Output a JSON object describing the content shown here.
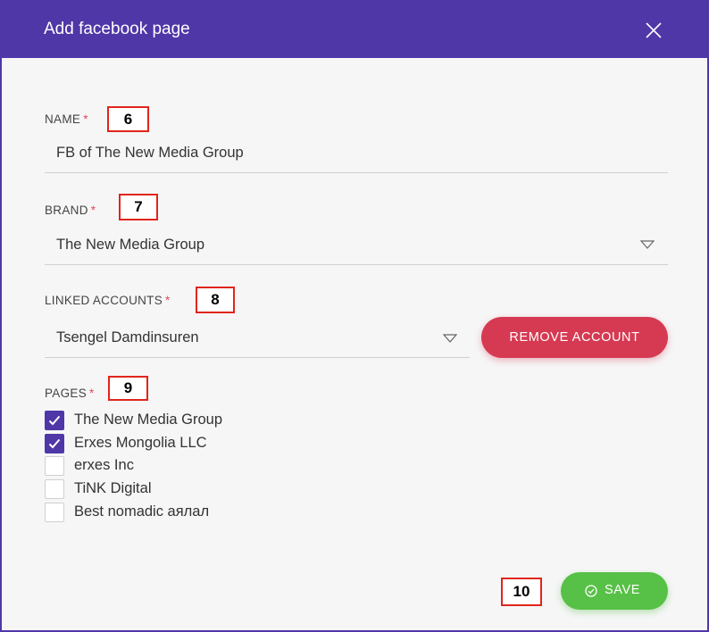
{
  "dialog": {
    "title": "Add facebook page",
    "close_icon": "close-icon"
  },
  "form": {
    "name": {
      "label": "NAME",
      "required": "*",
      "value": "FB of The New Media Group"
    },
    "brand": {
      "label": "BRAND",
      "required": "*",
      "value": "The New Media Group"
    },
    "linked_accounts": {
      "label": "LINKED ACCOUNTS",
      "required": "*",
      "value": "Tsengel Damdinsuren",
      "remove_label": "REMOVE ACCOUNT"
    },
    "pages": {
      "label": "PAGES",
      "required": "*",
      "items": [
        {
          "label": "The New Media Group",
          "checked": true
        },
        {
          "label": "Erxes Mongolia LLC",
          "checked": true
        },
        {
          "label": "erxes Inc",
          "checked": false
        },
        {
          "label": "TiNK Digital",
          "checked": false
        },
        {
          "label": "Best nomadic аялал",
          "checked": false
        }
      ]
    }
  },
  "footer": {
    "save_label": "SAVE"
  },
  "annotations": {
    "name": "6",
    "brand": "7",
    "linked_accounts": "8",
    "pages": "9",
    "save": "10"
  },
  "colors": {
    "header": "#4f37a8",
    "remove": "#d63a52",
    "save": "#57c046",
    "required": "#e04b5e",
    "annotation_border": "#e1251b"
  }
}
